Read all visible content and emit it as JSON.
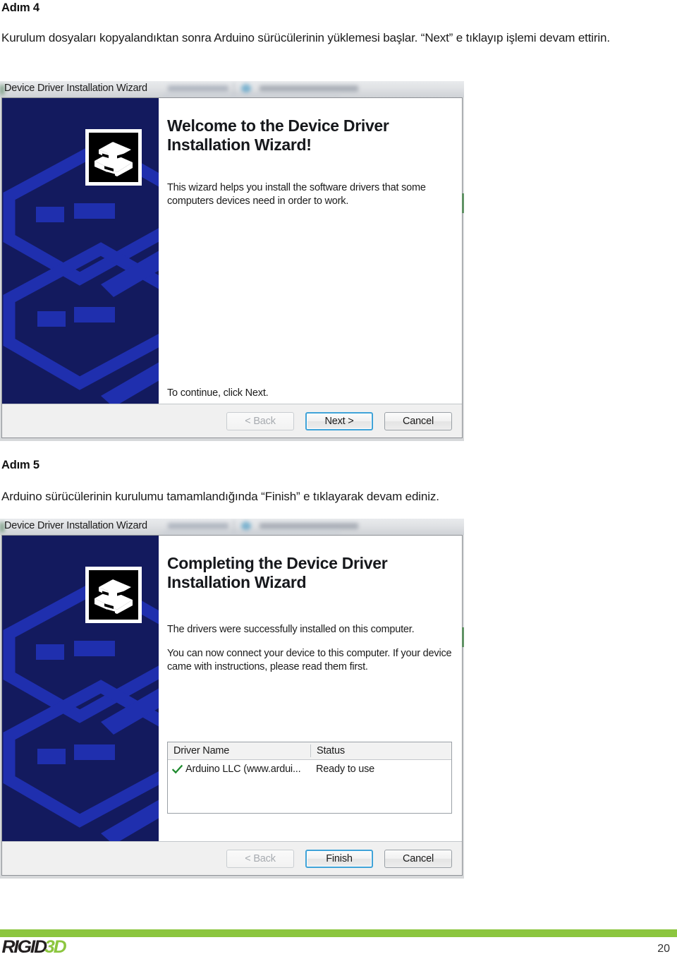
{
  "document": {
    "step4": {
      "heading": "Adım 4",
      "paragraph": "Kurulum dosyaları kopyalandıktan sonra Arduino sürücülerinin yüklemesi başlar. “Next” e tıklayıp işlemi devam ettirin."
    },
    "step5": {
      "heading": "Adım 5",
      "paragraph": "Arduino sürücülerinin kurulumu tamamlandığında “Finish” e tıklayarak devam ediniz."
    }
  },
  "screenshot1": {
    "window_title": "Device Driver Installation Wizard",
    "heading": "Welcome to the Device Driver Installation Wizard!",
    "body": "This wizard helps you install the software drivers that some computers devices need in order to work.",
    "hint": "To continue, click Next.",
    "buttons": {
      "back": "< Back",
      "next": "Next >",
      "cancel": "Cancel"
    },
    "icons": {
      "wizard": "device-driver-icon"
    }
  },
  "screenshot2": {
    "window_title": "Device Driver Installation Wizard",
    "heading": "Completing the Device Driver Installation Wizard",
    "body1": "The drivers were successfully installed on this computer.",
    "body2": "You can now connect your device to this computer. If your device came with instructions, please read them first.",
    "table": {
      "columns": [
        "Driver Name",
        "Status"
      ],
      "rows": [
        {
          "name": "Arduino LLC (www.ardui...",
          "status": "Ready to use",
          "icon": "green-check-icon"
        }
      ]
    },
    "buttons": {
      "back": "< Back",
      "finish": "Finish",
      "cancel": "Cancel"
    },
    "icons": {
      "wizard": "device-driver-icon"
    }
  },
  "footer": {
    "logo_primary": "RIGID",
    "logo_accent": "3D",
    "page_number": "20"
  },
  "colors": {
    "brand_green": "#8cc63f",
    "wizard_blue": "#131a5e",
    "watermark_blue": "#1f2fae",
    "focus_blue": "#3fa3d8",
    "check_green": "#1e8a2e"
  }
}
